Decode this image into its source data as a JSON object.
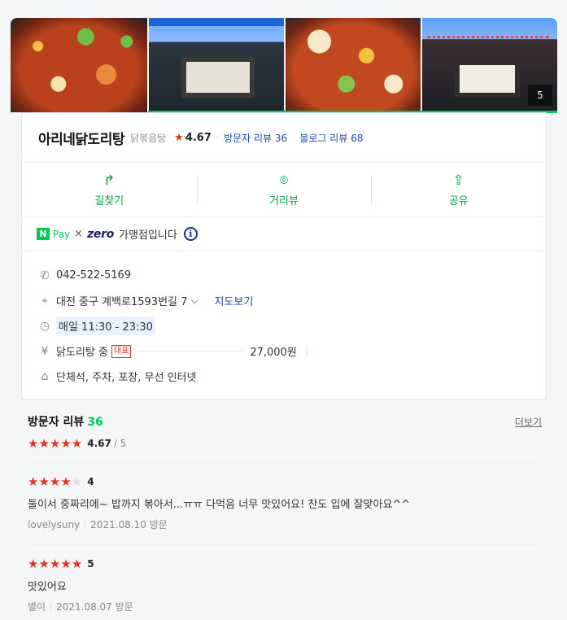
{
  "photos": {
    "count_label": "5"
  },
  "place": {
    "name": "아리네닭도리탕",
    "category": "닭볶음탕",
    "rating": "4.67",
    "visitor_reviews": "방문자 리뷰 36",
    "blog_reviews": "블로그 리뷰 68"
  },
  "actions": [
    {
      "label": "길찾기",
      "icon": "directions-icon"
    },
    {
      "label": "거리뷰",
      "icon": "streetview-icon"
    },
    {
      "label": "공유",
      "icon": "share-icon"
    }
  ],
  "pay": {
    "npay_logo": "N",
    "npay_text": "Pay",
    "times": "×",
    "zero_logo": "zero",
    "label": "가맹점입니다",
    "info": "i"
  },
  "details": {
    "phone": "042-522-5169",
    "address": "대전 중구 계백로1593번길 7",
    "map_link": "지도보기",
    "hours": "매일 11:30 - 23:30",
    "menu_name": "닭도리탕 중",
    "menu_badge": "대표",
    "menu_price": "27,000원",
    "amenities": "단체석, 주차, 포장, 무선 인터넷"
  },
  "reviews": {
    "title": "방문자 리뷰",
    "count": "36",
    "more": "더보기",
    "score": "4.67",
    "score_max": "/ 5",
    "items": [
      {
        "stars": 4,
        "score": "4",
        "text": "둘이서 중짜리에~ 밥까지 볶아서...ㅠㅠ 다먹음 너무 맛있어요! 찬도 입에 잘맞아요^^",
        "author": "lovelysuny",
        "date": "2021.08.10 방문"
      },
      {
        "stars": 5,
        "score": "5",
        "text": "맛있어요",
        "author": "별이",
        "date": "2021.08.07 방문"
      }
    ]
  },
  "colors": {
    "accent_green": "#03c75a",
    "star_red": "#e0341c",
    "link_blue": "#1f4aa8"
  }
}
